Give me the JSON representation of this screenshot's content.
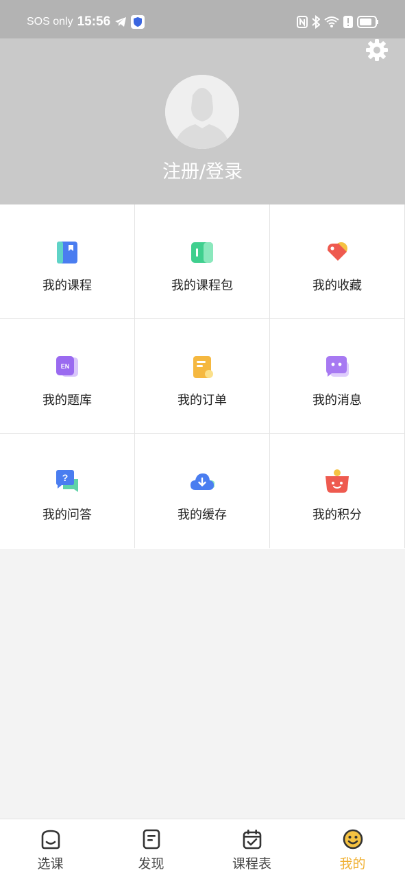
{
  "status_bar": {
    "carrier": "SOS only",
    "time": "15:56"
  },
  "header": {
    "login_label": "注册/登录"
  },
  "menu": [
    {
      "label": "我的课程",
      "icon": "book-icon",
      "color": "#4a7df0"
    },
    {
      "label": "我的课程包",
      "icon": "course-pack-icon",
      "color": "#3fcf8e"
    },
    {
      "label": "我的收藏",
      "icon": "heart-tag-icon",
      "color": "#ee5a4f"
    },
    {
      "label": "我的题库",
      "icon": "question-bank-icon",
      "color": "#9a6af0"
    },
    {
      "label": "我的订单",
      "icon": "order-icon",
      "color": "#f5b840"
    },
    {
      "label": "我的消息",
      "icon": "message-icon",
      "color": "#a779f2"
    },
    {
      "label": "我的问答",
      "icon": "qa-icon",
      "color": "#4a7df0"
    },
    {
      "label": "我的缓存",
      "icon": "cloud-download-icon",
      "color": "#4a7df0"
    },
    {
      "label": "我的积分",
      "icon": "points-icon",
      "color": "#ee5a4f"
    }
  ],
  "tabs": [
    {
      "label": "选课",
      "icon": "select-course-icon",
      "active": false
    },
    {
      "label": "发现",
      "icon": "discover-icon",
      "active": false
    },
    {
      "label": "课程表",
      "icon": "calendar-icon",
      "active": false
    },
    {
      "label": "我的",
      "icon": "smiley-icon",
      "active": true
    }
  ],
  "colors": {
    "accent": "#f0b032",
    "header_bg": "#c9c9c9",
    "status_bg": "#b3b3b3"
  }
}
